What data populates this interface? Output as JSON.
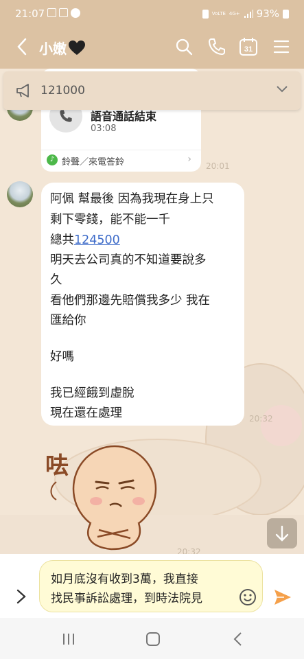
{
  "status": {
    "time": "21:07",
    "network": "4G+",
    "volte": "VoLTE",
    "battery": "93%"
  },
  "header": {
    "title": "小嫩"
  },
  "announcement": {
    "text": "121000"
  },
  "call_card": {
    "title": "語音通話結束",
    "duration": "03:08",
    "ringtone_label": "鈴聲／來電答鈴",
    "time": "20:01"
  },
  "message": {
    "line1": "阿佩 幫最後 因為我現在身上只",
    "line2": "剩下零錢，能不能一千",
    "line3_prefix": "總共",
    "line3_link": "124500",
    "line4": "明天去公司真的不知道要說多",
    "line5": "久",
    "line6": "看他們那邊先賠償我多少 我在",
    "line7": "匯給你",
    "line8": "好嗎",
    "line9": "我已經餓到虛脫",
    "line10": "現在還在處理",
    "time": "20:32"
  },
  "sticker": {
    "glyph": "呿",
    "time": "20:32"
  },
  "input": {
    "line1": "如月底沒有收到3萬，我直接",
    "line2": "找民事訴訟處理，到時法院見"
  },
  "colors": {
    "header_bg": "#dcc2a3",
    "chat_bg": "#f3e6d6",
    "send": "#f5a04a",
    "link": "#3d6bc9"
  }
}
